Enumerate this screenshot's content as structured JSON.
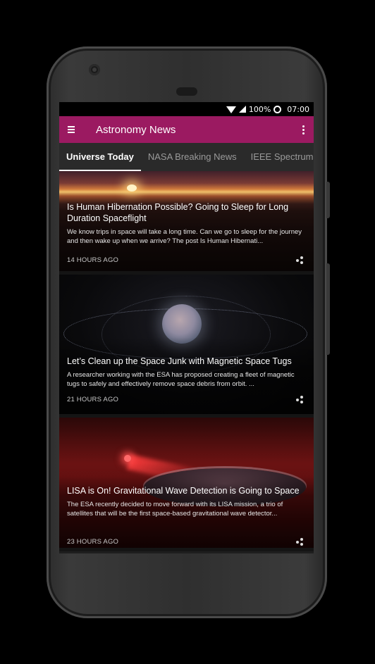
{
  "status_bar": {
    "battery": "100%",
    "time": "07:00"
  },
  "app_bar": {
    "title": "Astronomy News"
  },
  "tabs": [
    {
      "label": "Universe Today",
      "active": true
    },
    {
      "label": "NASA Breaking News",
      "active": false
    },
    {
      "label": "IEEE Spectrum Aer",
      "active": false
    }
  ],
  "articles": [
    {
      "title": "Is Human Hibernation Possible? Going to Sleep for Long Duration Spaceflight",
      "description": "We know trips in space will take a long time. Can we go to sleep for the journey and then wake up when we arrive? The post Is Human Hibernati...",
      "time": "14 HOURS AGO",
      "image": "sunset-horizon"
    },
    {
      "title": "Let’s Clean up the Space Junk with Magnetic Space Tugs",
      "description": "A researcher working with the ESA has proposed creating a fleet of magnetic tugs to safely and effectively remove space debris from orbit. ...",
      "time": "21 HOURS AGO",
      "image": "earth-debris-field"
    },
    {
      "title": "LISA is On! Gravitational Wave Detection is Going to Space",
      "description": "The ESA recently decided to move forward with its LISA mission, a trio of satellites that will be the first space-based gravitational wave detector...",
      "time": "23 HOURS AGO",
      "image": "lisa-satellite-laser"
    }
  ],
  "icons": {
    "menu": "hamburger-icon",
    "overflow": "more-vert-icon",
    "share": "share-icon",
    "wifi": "wifi-icon",
    "signal": "cell-signal-icon",
    "battery": "battery-icon"
  },
  "colors": {
    "app_bar": "#9b1a61",
    "tab_bar": "#2a2a2a",
    "background": "#1e1e1e"
  }
}
